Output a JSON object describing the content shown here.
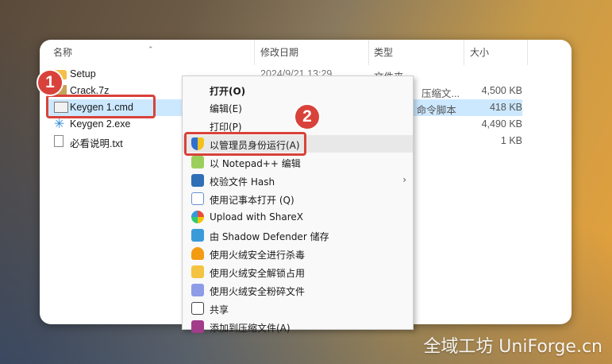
{
  "columns": {
    "name": "名称",
    "date": "修改日期",
    "type": "类型",
    "size": "大小"
  },
  "files": [
    {
      "name": "Setup",
      "date": "2024/9/21 13:29",
      "type": "文件夹",
      "size": "",
      "icon": "folder-icon"
    },
    {
      "name": "Crack.7z",
      "date": "",
      "type": "压缩文...",
      "size": "4,500 KB",
      "icon": "archive-icon"
    },
    {
      "name": "Keygen 1.cmd",
      "date": "",
      "type": "s 命令脚本",
      "size": "418 KB",
      "icon": "cmd-script-icon"
    },
    {
      "name": "Keygen 2.exe",
      "date": "",
      "type": "",
      "size": "4,490 KB",
      "icon": "exe-icon"
    },
    {
      "name": "必看说明.txt",
      "date": "",
      "type": "",
      "size": "1 KB",
      "icon": "text-file-icon"
    }
  ],
  "context_menu": [
    {
      "label": "打开(O)",
      "bold": true,
      "icon": ""
    },
    {
      "label": "编辑(E)",
      "icon": ""
    },
    {
      "label": "打印(P)",
      "icon": ""
    },
    {
      "label": "以管理员身份运行(A)",
      "icon": "uac-shield-icon"
    },
    {
      "label": "以 Notepad++ 编辑",
      "icon": "notepadpp-icon"
    },
    {
      "label": "校验文件 Hash",
      "icon": "hash-icon",
      "submenu": true
    },
    {
      "label": "使用记事本打开 (Q)",
      "icon": "notepad-icon"
    },
    {
      "label": "Upload with ShareX",
      "icon": "sharex-icon"
    },
    {
      "label": "由 Shadow Defender 储存",
      "icon": "shadow-defender-icon"
    },
    {
      "label": "使用火绒安全进行杀毒",
      "icon": "huorong-icon"
    },
    {
      "label": "使用火绒安全解锁占用",
      "icon": "huorong-unlock-icon"
    },
    {
      "label": "使用火绒安全粉碎文件",
      "icon": "huorong-shred-icon"
    },
    {
      "label": "共享",
      "icon": "share-icon"
    },
    {
      "label": "添加到压缩文件(A)",
      "icon": "winrar-icon"
    }
  ],
  "badges": {
    "one": "1",
    "two": "2"
  },
  "watermark": "全域工坊 UniForge.cn",
  "colors": {
    "highlight": "#d9423a",
    "selection": "#cce8ff"
  }
}
